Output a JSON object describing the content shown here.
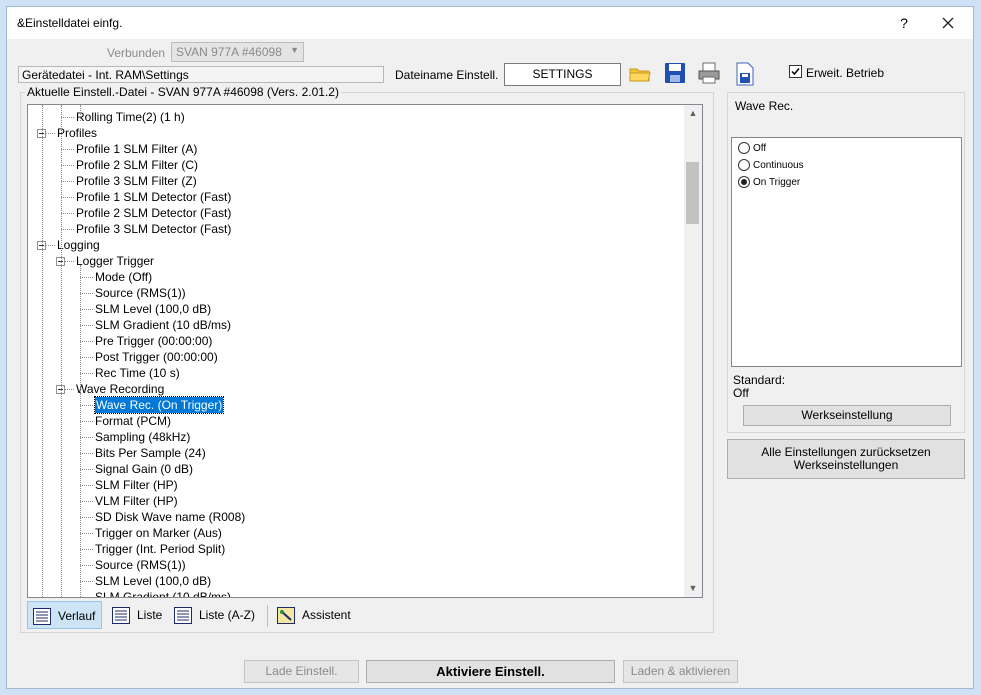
{
  "window": {
    "title": "&Einstelldatei einfg.",
    "help_label": "?"
  },
  "header": {
    "connected_label": "Verbunden",
    "device_combo_value": "SVAN 977A #46098",
    "device_path": "Gerätedatei - Int. RAM\\Settings",
    "filename_label": "Dateiname Einstell.",
    "filename_value": "SETTINGS",
    "extended_mode_label": "Erweit. Betrieb",
    "extended_mode_checked": true
  },
  "tree_group_label": "Aktuelle Einstell.-Datei - SVAN 977A #46098 (Vers. 2.01.2)",
  "tree": {
    "nodes": [
      {
        "label": "Rolling Time(2) (1 h)",
        "level": 2
      },
      {
        "label": "Profiles",
        "level": 1,
        "expanded": true
      },
      {
        "label": "Profile 1 SLM Filter (A)",
        "level": 2
      },
      {
        "label": "Profile 2 SLM Filter (C)",
        "level": 2
      },
      {
        "label": "Profile 3 SLM Filter (Z)",
        "level": 2
      },
      {
        "label": "Profile 1 SLM Detector (Fast)",
        "level": 2
      },
      {
        "label": "Profile 2 SLM Detector (Fast)",
        "level": 2
      },
      {
        "label": "Profile 3 SLM Detector (Fast)",
        "level": 2
      },
      {
        "label": "Logging",
        "level": 1,
        "expanded": true
      },
      {
        "label": "Logger Trigger",
        "level": 2,
        "expanded": true
      },
      {
        "label": "Mode (Off)",
        "level": 3
      },
      {
        "label": "Source (RMS(1))",
        "level": 3
      },
      {
        "label": "SLM Level (100,0 dB)",
        "level": 3
      },
      {
        "label": "SLM Gradient (10 dB/ms)",
        "level": 3
      },
      {
        "label": "Pre Trigger (00:00:00)",
        "level": 3
      },
      {
        "label": "Post Trigger (00:00:00)",
        "level": 3
      },
      {
        "label": "Rec Time (10 s)",
        "level": 3
      },
      {
        "label": "Wave Recording",
        "level": 2,
        "expanded": true
      },
      {
        "label": "Wave Rec. (On Trigger)",
        "level": 3,
        "selected": true
      },
      {
        "label": "Format (PCM)",
        "level": 3
      },
      {
        "label": "Sampling (48kHz)",
        "level": 3
      },
      {
        "label": "Bits Per Sample (24)",
        "level": 3
      },
      {
        "label": "Signal Gain (0 dB)",
        "level": 3
      },
      {
        "label": "SLM Filter (HP)",
        "level": 3
      },
      {
        "label": "VLM Filter (HP)",
        "level": 3
      },
      {
        "label": "SD Disk Wave name (R008)",
        "level": 3
      },
      {
        "label": "Trigger on Marker (Aus)",
        "level": 3
      },
      {
        "label": "Trigger (Int. Period Split)",
        "level": 3
      },
      {
        "label": "Source (RMS(1))",
        "level": 3
      },
      {
        "label": "SLM Level (100,0 dB)",
        "level": 3
      },
      {
        "label": "SLM Gradient (10 dB/ms)",
        "level": 3
      }
    ]
  },
  "view_tabs": {
    "history": "Verlauf",
    "list": "Liste",
    "list_az": "Liste (A-Z)",
    "assistant": "Assistent"
  },
  "right_panel": {
    "title": "Wave Rec.",
    "options": [
      "Off",
      "Continuous",
      "On Trigger"
    ],
    "selected_option": "On Trigger",
    "standard_label": "Standard:",
    "standard_value": "Off",
    "factory_button": "Werkseinstellung",
    "reset_all_line1": "Alle Einstellungen zurücksetzen",
    "reset_all_line2": "Werkseinstellungen"
  },
  "footer": {
    "load_button": "Lade Einstell.",
    "activate_button": "Aktiviere Einstell.",
    "load_activate_button": "Laden & aktivieren"
  },
  "colors": {
    "selection": "#0078d7",
    "window_bg": "#f0f0f0",
    "desktop_bg": "#cfe2f5"
  }
}
